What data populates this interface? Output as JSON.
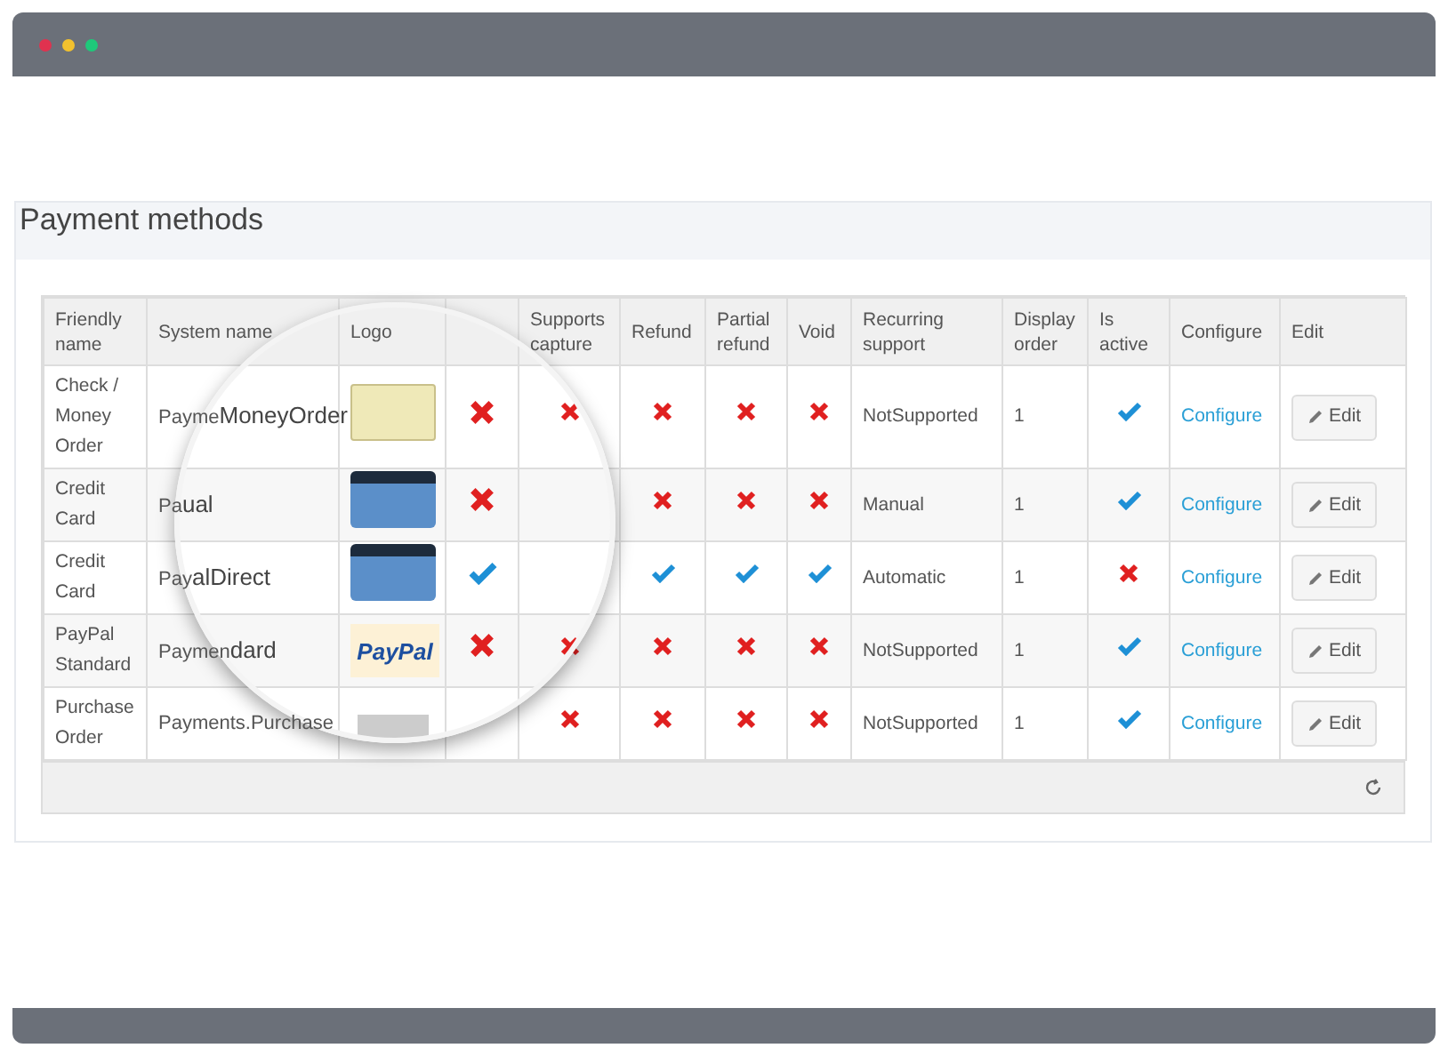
{
  "title": "Payment methods",
  "columns": [
    {
      "label": "Friendly name"
    },
    {
      "label": "System name"
    },
    {
      "label": "Logo"
    },
    {},
    {
      "label": "Supports capture"
    },
    {
      "label": "Refund"
    },
    {
      "label": "Partial refund"
    },
    {
      "label": "Void"
    },
    {
      "label": "Recurring support"
    },
    {
      "label": "Display order"
    },
    {
      "label": "Is active"
    },
    {
      "label": "Configure"
    },
    {
      "label": "Edit"
    }
  ],
  "rows": [
    {
      "friendly_name": "Check / Money Order",
      "system_name": [
        "Payme",
        "MoneyOrder"
      ],
      "logo": {
        "kind": "check"
      },
      "column_4": false,
      "supports_capture": false,
      "refund": false,
      "partial_refund": false,
      "void": false,
      "recurring_support": "NotSupported",
      "display_order": "1",
      "is_active": true,
      "configure": "Configure",
      "edit": "Edit"
    },
    {
      "friendly_name": "Credit Card",
      "system_name": [
        "Pa",
        "ual"
      ],
      "logo": {
        "kind": "card"
      },
      "column_4": false,
      "refund": false,
      "partial_refund": false,
      "void": false,
      "recurring_support": "Manual",
      "display_order": "1",
      "is_active": true,
      "configure": "Configure",
      "edit": "Edit"
    },
    {
      "friendly_name": "Credit Card",
      "system_name": [
        "Pay",
        "alDirect"
      ],
      "logo": {
        "kind": "card"
      },
      "column_4": true,
      "refund": true,
      "partial_refund": true,
      "void": true,
      "recurring_support": "Automatic",
      "display_order": "1",
      "is_active": false,
      "configure": "Configure",
      "edit": "Edit"
    },
    {
      "friendly_name": "PayPal Standard",
      "system_name": [
        "Paymen",
        "dard"
      ],
      "logo": {
        "kind": "paypal",
        "text": "PayPal"
      },
      "column_4": false,
      "supports_capture": false,
      "refund": false,
      "partial_refund": false,
      "void": false,
      "recurring_support": "NotSupported",
      "display_order": "1",
      "is_active": true,
      "configure": "Configure",
      "edit": "Edit"
    },
    {
      "friendly_name": "Purchase Order",
      "system_name": [
        "Payments.Purchase"
      ],
      "logo": {
        "kind": "partial"
      },
      "supports_capture": false,
      "refund": false,
      "partial_refund": false,
      "void": false,
      "recurring_support": "NotSupported",
      "display_order": "1",
      "is_active": true,
      "configure": "Configure",
      "edit": "Edit"
    }
  ]
}
